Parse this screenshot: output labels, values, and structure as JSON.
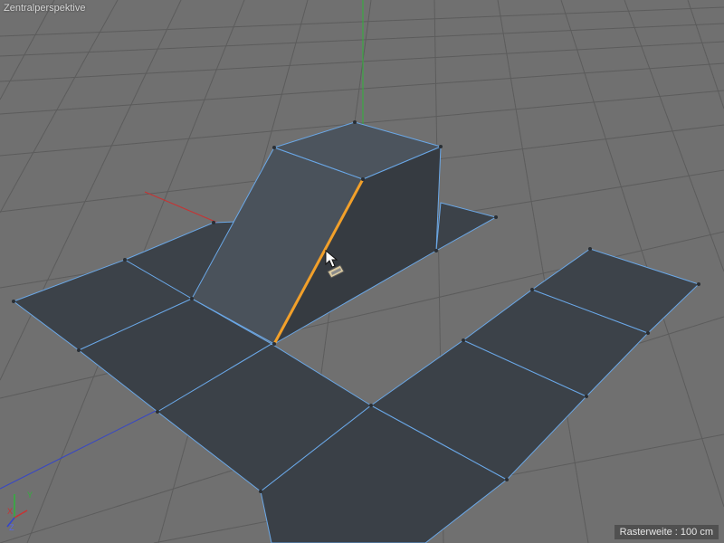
{
  "viewport": {
    "title": "Zentralperspektive",
    "grid_spacing": "Rasterweite : 100 cm"
  },
  "gizmo": {
    "x": "X",
    "y": "Y",
    "z": "Z"
  },
  "colors": {
    "background": "#6f6f6f",
    "grid": "#5e5e5e",
    "face_dark": "#3a3f45",
    "face_mid": "#454c54",
    "face_light": "#4a525b",
    "wire": "#6aa7e6",
    "selected_edge": "#f2a02a",
    "axis_x": "#c83232",
    "axis_y": "#2fb33a",
    "axis_z": "#3344cc"
  }
}
